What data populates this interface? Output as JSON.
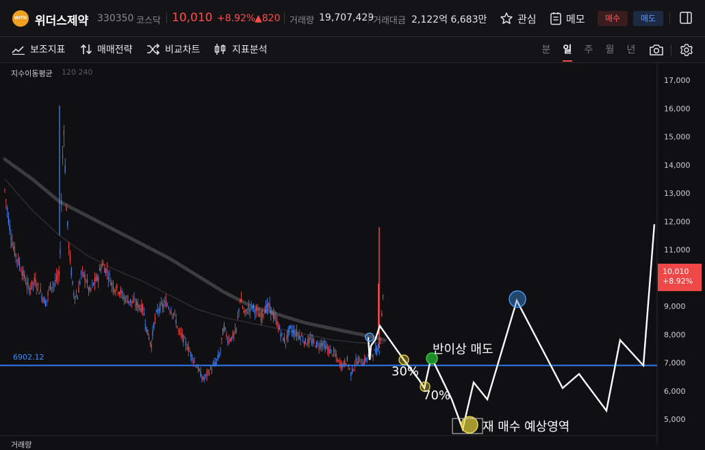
{
  "header": {
    "logo_text": "WITH",
    "name": "위더스제약",
    "code": "330350",
    "market": "코스닥",
    "price": "10,010",
    "change_pct": "+8.92%",
    "change": "▲820",
    "volume_label": "거래량",
    "volume": "19,707,429",
    "amount_label": "거래대금",
    "amount": "2,122억 6,683만",
    "watch_label": "관심",
    "memo_label": "메모",
    "buy_label": "매수",
    "sell_label": "매도"
  },
  "toolbar": {
    "tools": [
      "보조지표",
      "매매전략",
      "비교차트",
      "지표분석"
    ],
    "periods": [
      "분",
      "일",
      "주",
      "월",
      "년"
    ],
    "active_period": "일"
  },
  "chart": {
    "ma_label": "지수이동평균",
    "ma_periods": "120 240",
    "volume_label": "거래량",
    "price_tag": {
      "price": "10,010",
      "pct": "+8.92%"
    },
    "hline_label": "6902.12",
    "annotations": {
      "sell_half": "반이상 매도",
      "pct30": "30%",
      "pct70": "70%",
      "rebuy": "재 매수 예상영역"
    },
    "colors": {
      "up": "#ff4d4d",
      "down": "#4d8dff",
      "hline": "#2f7cf6",
      "ma": "#3c3c40",
      "path": "#ffffff"
    }
  },
  "chart_data": {
    "type": "line",
    "y_axis_ticks": [
      "17,000",
      "16,000",
      "15,000",
      "14,000",
      "13,000",
      "12,000",
      "11,000",
      "10,000",
      "9,000",
      "8,000",
      "7,000",
      "6,000",
      "5,000"
    ],
    "ylim": [
      4500,
      17600
    ],
    "horizontal_line": 6902.12,
    "last_price": 10010,
    "price_history": [
      [
        0,
        13100
      ],
      [
        6,
        12000
      ],
      [
        12,
        11100
      ],
      [
        18,
        10700
      ],
      [
        26,
        10200
      ],
      [
        35,
        9600
      ],
      [
        44,
        9900
      ],
      [
        52,
        9500
      ],
      [
        60,
        9100
      ],
      [
        66,
        9700
      ],
      [
        72,
        9800
      ],
      [
        80,
        10100
      ],
      [
        86,
        15600
      ],
      [
        90,
        12500
      ],
      [
        94,
        11000
      ],
      [
        100,
        9500
      ],
      [
        106,
        9300
      ],
      [
        112,
        10200
      ],
      [
        118,
        10000
      ],
      [
        124,
        9500
      ],
      [
        130,
        9800
      ],
      [
        136,
        10000
      ],
      [
        142,
        10500
      ],
      [
        150,
        10200
      ],
      [
        158,
        9700
      ],
      [
        166,
        9600
      ],
      [
        174,
        9300
      ],
      [
        182,
        9200
      ],
      [
        190,
        9100
      ],
      [
        196,
        9000
      ],
      [
        202,
        8900
      ],
      [
        208,
        8100
      ],
      [
        214,
        7600
      ],
      [
        218,
        8400
      ],
      [
        224,
        8900
      ],
      [
        230,
        9000
      ],
      [
        236,
        9100
      ],
      [
        242,
        8900
      ],
      [
        248,
        8700
      ],
      [
        254,
        8100
      ],
      [
        260,
        7900
      ],
      [
        266,
        7600
      ],
      [
        272,
        7300
      ],
      [
        278,
        7000
      ],
      [
        284,
        6700
      ],
      [
        290,
        6400
      ],
      [
        296,
        6600
      ],
      [
        302,
        6800
      ],
      [
        308,
        7000
      ],
      [
        314,
        7300
      ],
      [
        320,
        8300
      ],
      [
        326,
        7800
      ],
      [
        332,
        7900
      ],
      [
        338,
        8100
      ],
      [
        344,
        9300
      ],
      [
        350,
        8700
      ],
      [
        356,
        8900
      ],
      [
        362,
        9000
      ],
      [
        368,
        8800
      ],
      [
        374,
        8600
      ],
      [
        380,
        8900
      ],
      [
        386,
        9000
      ],
      [
        392,
        8700
      ],
      [
        398,
        8400
      ],
      [
        404,
        8000
      ],
      [
        410,
        7700
      ],
      [
        416,
        8200
      ],
      [
        422,
        8100
      ],
      [
        428,
        8000
      ],
      [
        434,
        7900
      ],
      [
        440,
        7700
      ],
      [
        446,
        7800
      ],
      [
        452,
        7700
      ],
      [
        458,
        7600
      ],
      [
        464,
        7700
      ],
      [
        470,
        7500
      ],
      [
        476,
        7400
      ],
      [
        482,
        7300
      ],
      [
        488,
        7000
      ],
      [
        494,
        6900
      ],
      [
        500,
        7100
      ],
      [
        506,
        6600
      ],
      [
        512,
        7000
      ],
      [
        518,
        7100
      ],
      [
        524,
        7000
      ],
      [
        530,
        7200
      ],
      [
        536,
        7300
      ],
      [
        542,
        7400
      ],
      [
        548,
        7500
      ],
      [
        552,
        9200
      ],
      [
        554,
        10010
      ]
    ],
    "ma_long": [
      [
        0,
        14200
      ],
      [
        40,
        13500
      ],
      [
        80,
        12700
      ],
      [
        120,
        12200
      ],
      [
        160,
        11700
      ],
      [
        200,
        11200
      ],
      [
        240,
        10700
      ],
      [
        280,
        10100
      ],
      [
        320,
        9500
      ],
      [
        360,
        9000
      ],
      [
        400,
        8700
      ],
      [
        440,
        8400
      ],
      [
        480,
        8200
      ],
      [
        520,
        8000
      ],
      [
        555,
        7800
      ]
    ],
    "ma_short": [
      [
        0,
        13500
      ],
      [
        40,
        12400
      ],
      [
        80,
        11500
      ],
      [
        120,
        10800
      ],
      [
        160,
        10300
      ],
      [
        200,
        9900
      ],
      [
        240,
        9400
      ],
      [
        280,
        8900
      ],
      [
        320,
        8600
      ],
      [
        360,
        8400
      ],
      [
        400,
        8200
      ],
      [
        440,
        8000
      ],
      [
        480,
        7800
      ],
      [
        520,
        7700
      ],
      [
        555,
        7700
      ]
    ],
    "scenario_path": [
      [
        538,
        7900
      ],
      [
        540,
        7100
      ],
      [
        542,
        7600
      ],
      [
        548,
        7800
      ],
      [
        555,
        8300
      ],
      [
        590,
        7100
      ],
      [
        612,
        6400
      ],
      [
        620,
        6100
      ],
      [
        630,
        7200
      ],
      [
        660,
        5700
      ],
      [
        676,
        4650
      ],
      [
        692,
        6300
      ],
      [
        712,
        5700
      ],
      [
        755,
        9200
      ],
      [
        822,
        6100
      ],
      [
        846,
        6600
      ],
      [
        886,
        5300
      ],
      [
        906,
        7800
      ],
      [
        940,
        6900
      ],
      [
        956,
        11900
      ]
    ],
    "markers": [
      {
        "x": 540,
        "y": 7900,
        "style": "blue"
      },
      {
        "x": 590,
        "y": 7100,
        "style": "yellow"
      },
      {
        "x": 621,
        "y": 6150,
        "style": "yellow"
      },
      {
        "x": 631,
        "y": 7150,
        "style": "green"
      },
      {
        "x": 686,
        "y": 4800,
        "style": "yellow-large"
      },
      {
        "x": 756,
        "y": 9250,
        "style": "blue-large"
      }
    ]
  }
}
